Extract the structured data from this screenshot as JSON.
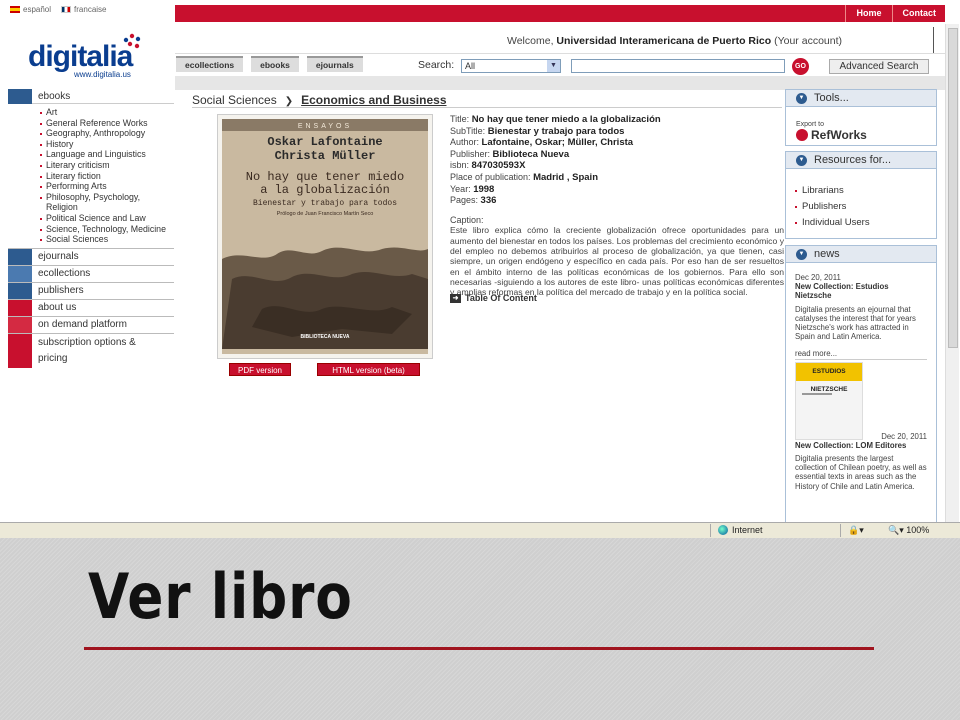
{
  "lang": {
    "es": "español",
    "fr": "francaise"
  },
  "topnav": [
    "Home",
    "Contact"
  ],
  "logo": {
    "word": "digitalia",
    "url": "www.digitalia.us"
  },
  "welcome": {
    "prefix": "Welcome,",
    "user": "Universidad Interamericana de Puerto Rico",
    "account": "(Your account)"
  },
  "tabs": [
    "ecollections",
    "ebooks",
    "ejournals"
  ],
  "search": {
    "label": "Search:",
    "scope": "All",
    "go": "GO",
    "advanced": "Advanced Search"
  },
  "sidebar": {
    "ebooks_label": "ebooks",
    "subjects": [
      "Art",
      "General Reference Works",
      "Geography, Anthropology",
      "History",
      "Language and Linguistics",
      "Literary criticism",
      "Literary fiction",
      "Performing Arts",
      "Philosophy, Psychology, Religion",
      "Political Science and Law",
      "Science, Technology, Medicine",
      "Social Sciences"
    ],
    "nav": [
      "ejournals",
      "ecollections",
      "publishers",
      "about us",
      "on demand platform",
      "subscription options & pricing"
    ]
  },
  "breadcrumb": {
    "parent": "Social Sciences",
    "current": "Economics and Business"
  },
  "cover": {
    "series": "ENSAYOS",
    "authors": [
      "Oskar Lafontaine",
      "Christa Müller"
    ],
    "title_lines": [
      "No hay que tener miedo",
      "a la globalización"
    ],
    "subtitle": "Bienestar y trabajo para todos",
    "prologue": "Prólogo de Juan Francisco Martín Seco",
    "publisher": "BIBLIOTECA NUEVA"
  },
  "buttons": {
    "pdf": "PDF version",
    "html": "HTML version (beta)"
  },
  "book": {
    "title_label": "Title:",
    "title": "No hay que tener miedo a la globalización",
    "subtitle_label": "SubTitle:",
    "subtitle": "Bienestar y trabajo para todos",
    "author_label": "Author:",
    "author": "Lafontaine, Oskar; Müller, Christa",
    "publisher_label": "Publisher:",
    "publisher": "Biblioteca Nueva",
    "isbn_label": "isbn:",
    "isbn": "847030593X",
    "place_label": "Place of publication:",
    "place": "Madrid , Spain",
    "year_label": "Year:",
    "year": "1998",
    "pages_label": "Pages:",
    "pages": "336",
    "caption_label": "Caption:",
    "caption": "Este libro explica cómo la creciente globalización ofrece oportunidades para un aumento del bienestar en todos los países. Los problemas del crecimiento económico y del empleo no debemos atribuirlos al proceso de globalización, ya que tienen, casi siempre, un origen endógeno y específico en cada país. Por eso han de ser resueltos en el ámbito interno de las políticas económicas de los gobiernos. Para ello son necesarias -siguiendo a los autores de este libro- unas políticas económicas diferentes y amplias reformas en la política del mercado de trabajo y en la política social.",
    "toc": "Table Of Content"
  },
  "tools": {
    "title": "Tools...",
    "export": "Export to",
    "refworks": "RefWorks"
  },
  "resources": {
    "title": "Resources for...",
    "items": [
      "Librarians",
      "Publishers",
      "Individual Users"
    ]
  },
  "news": {
    "title": "news",
    "items": [
      {
        "date": "Dec 20, 2011",
        "title": "New Collection: Estudios Nietzsche",
        "text": "Digitalia presents an ejournal that catalyses the interest that for years Nietzsche's work has attracted in Spain and Latin America."
      },
      {
        "date": "Dec 20, 2011",
        "title": "New Collection: LOM Editores",
        "text": "Digitalia presents the largest collection of Chilean poetry, as well as essential texts in areas such as the History of Chile and Latin America."
      }
    ],
    "read_more": "read more...",
    "thumb_label": "ESTUDIOS NIETZSCHE"
  },
  "statusbar": {
    "zone": "Internet",
    "zoom": "100%"
  },
  "slide": {
    "title": "Ver libro"
  },
  "colors": {
    "brand_red": "#c8102e",
    "brand_blue": "#2d5b8f",
    "title_rule": "#a0141f"
  }
}
